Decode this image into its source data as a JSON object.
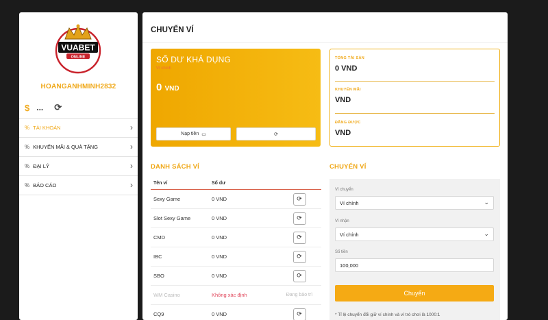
{
  "brand": {
    "logo_text": "VUABET",
    "logo_sub": "ONLINE"
  },
  "user": {
    "username": "HOANGANHMINH2832",
    "balance_masked": "...",
    "coin_icon": "coin-icon",
    "refresh_icon": "refresh-icon"
  },
  "sidebar": {
    "items": [
      {
        "label": "TÀI KHOẢN",
        "active": true
      },
      {
        "label": "KHUYẾN MÃI & QUÀ TẶNG",
        "active": false
      },
      {
        "label": "ĐẠI LÝ",
        "active": false
      },
      {
        "label": "BÁO CÁO",
        "active": false
      }
    ]
  },
  "page": {
    "title": "CHUYỂN VÍ"
  },
  "balance_card": {
    "label": "SỐ DƯ KHẢ DỤNG",
    "sub": "Ví chính",
    "amount": "0",
    "currency": "VND",
    "deposit_label": "Nạp tiền"
  },
  "summary": {
    "total_label": "TỔNG TÀI SẢN",
    "total_value": "0 VND",
    "promo_label": "KHUYẾN MÃI",
    "promo_value": "VND",
    "won_label": "ĐÃNG ĐƯỢC",
    "won_value": "VND"
  },
  "wallet_list": {
    "title": "DANH SÁCH VÍ",
    "col_name": "Tên ví",
    "col_balance": "Số dư",
    "rows": [
      {
        "name": "Sexy Game",
        "balance": "0 VND"
      },
      {
        "name": "Slot Sexy Game",
        "balance": "0 VND"
      },
      {
        "name": "CMD",
        "balance": "0 VND"
      },
      {
        "name": "IBC",
        "balance": "0 VND"
      },
      {
        "name": "SBO",
        "balance": "0 VND"
      },
      {
        "name": "WM Casino",
        "balance": "Không xác định",
        "status": "Đang bảo trì"
      },
      {
        "name": "CQ9",
        "balance": "0 VND"
      }
    ]
  },
  "transfer": {
    "title": "CHUYỂN VÍ",
    "from_label": "Ví chuyển",
    "from_value": "Ví chính",
    "to_label": "Ví nhận",
    "to_value": "Ví chính",
    "amount_label": "Số tiền",
    "amount_value": "100,000",
    "submit_label": "Chuyển",
    "note": "* Tỉ lệ chuyển đổi giữ ví chính và ví trò chơi là 1000:1"
  },
  "colors": {
    "accent": "#f0a818",
    "card_gradient_start": "#efa700",
    "card_gradient_end": "#f6bc14",
    "alert": "#e0455a"
  }
}
